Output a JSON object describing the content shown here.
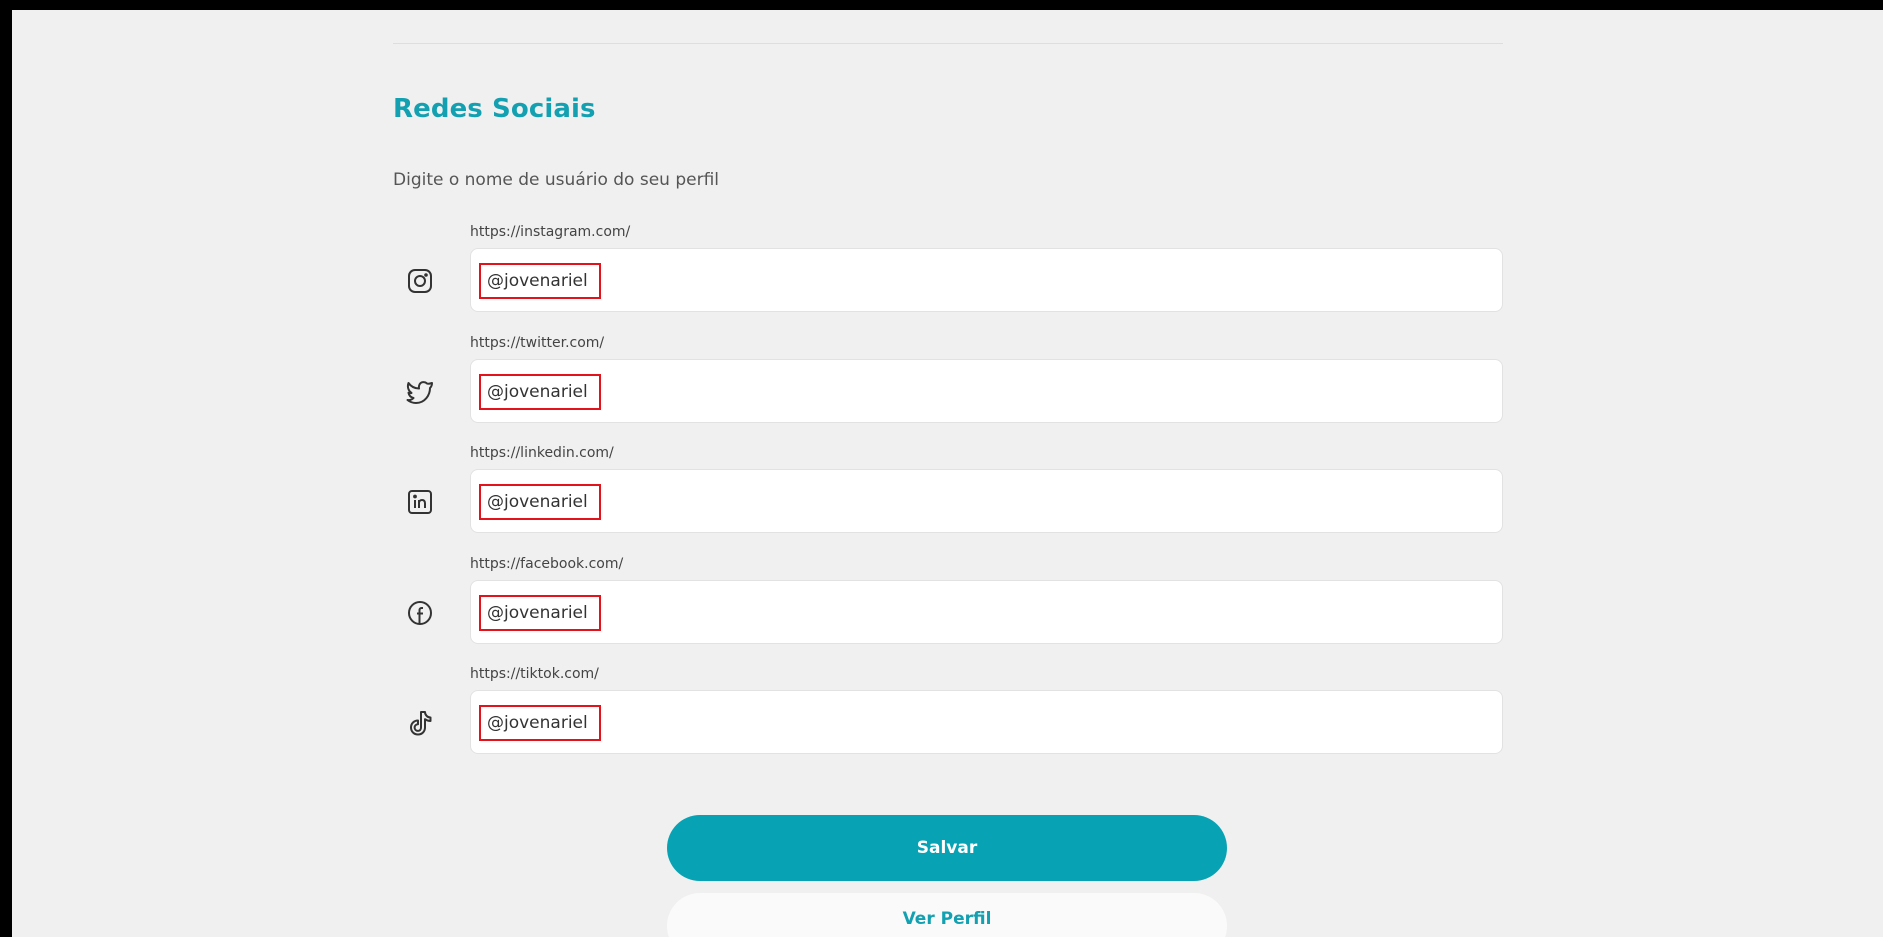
{
  "section": {
    "title": "Redes Sociais",
    "subtitle": "Digite o nome de usuário do seu perfil"
  },
  "social": [
    {
      "network": "instagram",
      "label": "https://instagram.com/",
      "value": "@jovenariel",
      "icon": "instagram-icon"
    },
    {
      "network": "twitter",
      "label": "https://twitter.com/",
      "value": "@jovenariel",
      "icon": "twitter-icon"
    },
    {
      "network": "linkedin",
      "label": "https://linkedin.com/",
      "value": "@jovenariel",
      "icon": "linkedin-icon"
    },
    {
      "network": "facebook",
      "label": "https://facebook.com/",
      "value": "@jovenariel",
      "icon": "facebook-icon"
    },
    {
      "network": "tiktok",
      "label": "https://tiktok.com/",
      "value": "@jovenariel",
      "icon": "tiktok-icon"
    }
  ],
  "actions": {
    "save_label": "Salvar",
    "profile_label": "Ver Perfil"
  },
  "colors": {
    "accent": "#07a3b4",
    "title": "#13a0b1",
    "highlight": "#e4121b",
    "background": "#f0f0f0"
  }
}
